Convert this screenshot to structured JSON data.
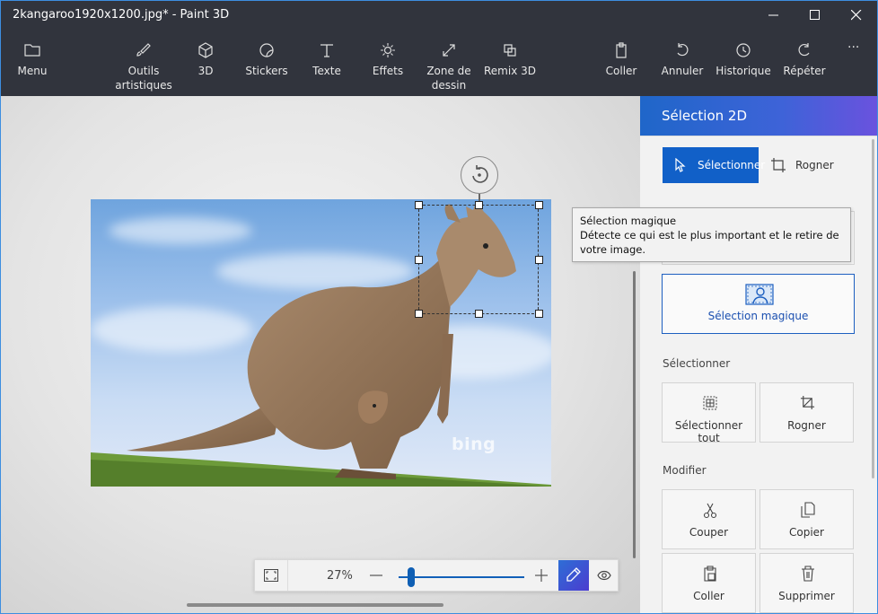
{
  "window": {
    "title": "2kangaroo1920x1200.jpg* - Paint 3D"
  },
  "ribbon": {
    "menu": "Menu",
    "tools_line1": "Outils",
    "tools_line2": "artistiques",
    "three_d": "3D",
    "stickers": "Stickers",
    "text": "Texte",
    "effects": "Effets",
    "canvas_line1": "Zone de",
    "canvas_line2": "dessin",
    "remix": "Remix 3D",
    "paste": "Coller",
    "undo": "Annuler",
    "history": "Historique",
    "redo": "Répéter",
    "more": "···"
  },
  "image": {
    "watermark": "bing"
  },
  "zoombar": {
    "zoom": "27%",
    "zoom_fraction": 0.1
  },
  "panel": {
    "title": "Sélection 2D",
    "tab_select": "Sélectionner",
    "tab_crop": "Rogner",
    "magic_select": "Sélection magique",
    "section_select": "Sélectionner",
    "select_all": "Sélectionner tout",
    "crop": "Rogner",
    "section_modify": "Modifier",
    "cut": "Couper",
    "copy": "Copier",
    "paste": "Coller",
    "delete": "Supprimer"
  },
  "tooltip": {
    "title": "Sélection magique",
    "body": "Détecte ce qui est le plus important et le retire de votre image."
  },
  "colors": {
    "accent": "#1160c8",
    "chrome": "#31343d"
  }
}
